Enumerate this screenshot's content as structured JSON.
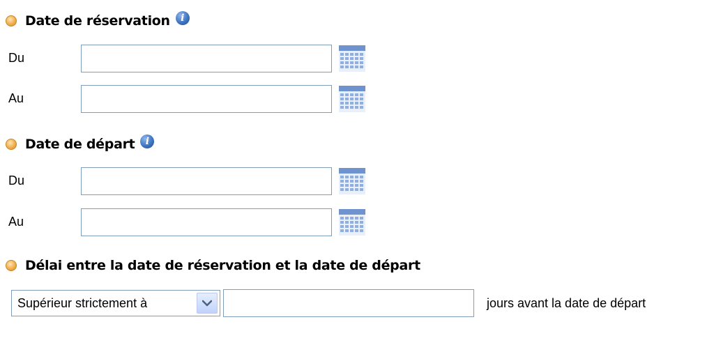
{
  "sections": {
    "reservation": {
      "title": "Date de réservation",
      "icon": "info-icon",
      "from_label": "Du",
      "from_value": "",
      "to_label": "Au",
      "to_value": ""
    },
    "departure": {
      "title": "Date de départ",
      "icon": "info-icon",
      "from_label": "Du",
      "from_value": "",
      "to_label": "Au",
      "to_value": ""
    },
    "delay": {
      "title": "Délai entre la date de réservation et la date de départ",
      "comparison_selected": "Supérieur strictement à",
      "days_value": "",
      "days_suffix": "jours avant la date de départ"
    }
  },
  "icons": {
    "bullet": "orange-bullet-icon",
    "info": "info-icon",
    "calendar": "calendar-icon",
    "dropdown": "chevron-down-icon"
  },
  "colors": {
    "input_border": "#7f9db9",
    "bullet": "#f4b85e",
    "info": "#3f75c2",
    "calendar": "#8fb0de"
  }
}
